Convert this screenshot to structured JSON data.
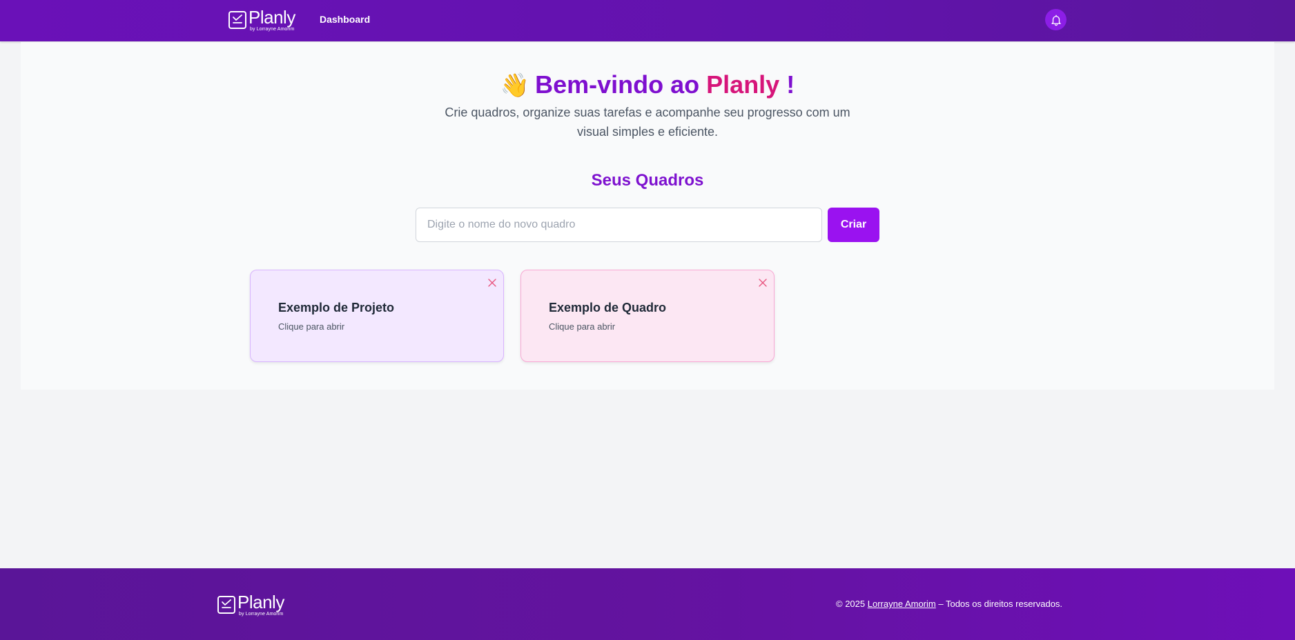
{
  "header": {
    "logo": {
      "word": "Planly",
      "byline": "by Lorrayne Amorim"
    },
    "nav": {
      "dashboard": "Dashboard"
    },
    "notification_icon": "bell-icon"
  },
  "hero": {
    "wave_icon": "👋",
    "title_prefix": "Bem-vindo ao",
    "title_brand": "Planly",
    "title_suffix": "!",
    "subtitle": "Crie quadros, organize suas tarefas e acompanhe seu progresso com um visual simples e eficiente."
  },
  "boards_section": {
    "title": "Seus Quadros",
    "input_placeholder": "Digite o nome do novo quadro",
    "input_value": "",
    "create_label": "Criar",
    "boards": [
      {
        "title": "Exemplo de Projeto",
        "subtitle": "Clique para abrir",
        "color": "#f3e8ff",
        "close_icon": "close-icon"
      },
      {
        "title": "Exemplo de Quadro",
        "subtitle": "Clique para abrir",
        "color": "#fce7f3",
        "close_icon": "close-icon"
      }
    ]
  },
  "footer": {
    "logo": {
      "word": "Planly",
      "byline": "by Lorrayne Amorim"
    },
    "copyright_prefix": "© 2025",
    "author_link": "Lorrayne Amorim",
    "copyright_suffix": "– Todos os direitos reservados."
  },
  "colors": {
    "header_bg": "#6a11b8",
    "accent_purple": "#9a12f0",
    "brand_pink": "#d6157a",
    "title_purple": "#7e0fcf",
    "card_purple": "#f3e8ff",
    "card_pink": "#fce7f3",
    "footer_bg": "#5a1598"
  }
}
